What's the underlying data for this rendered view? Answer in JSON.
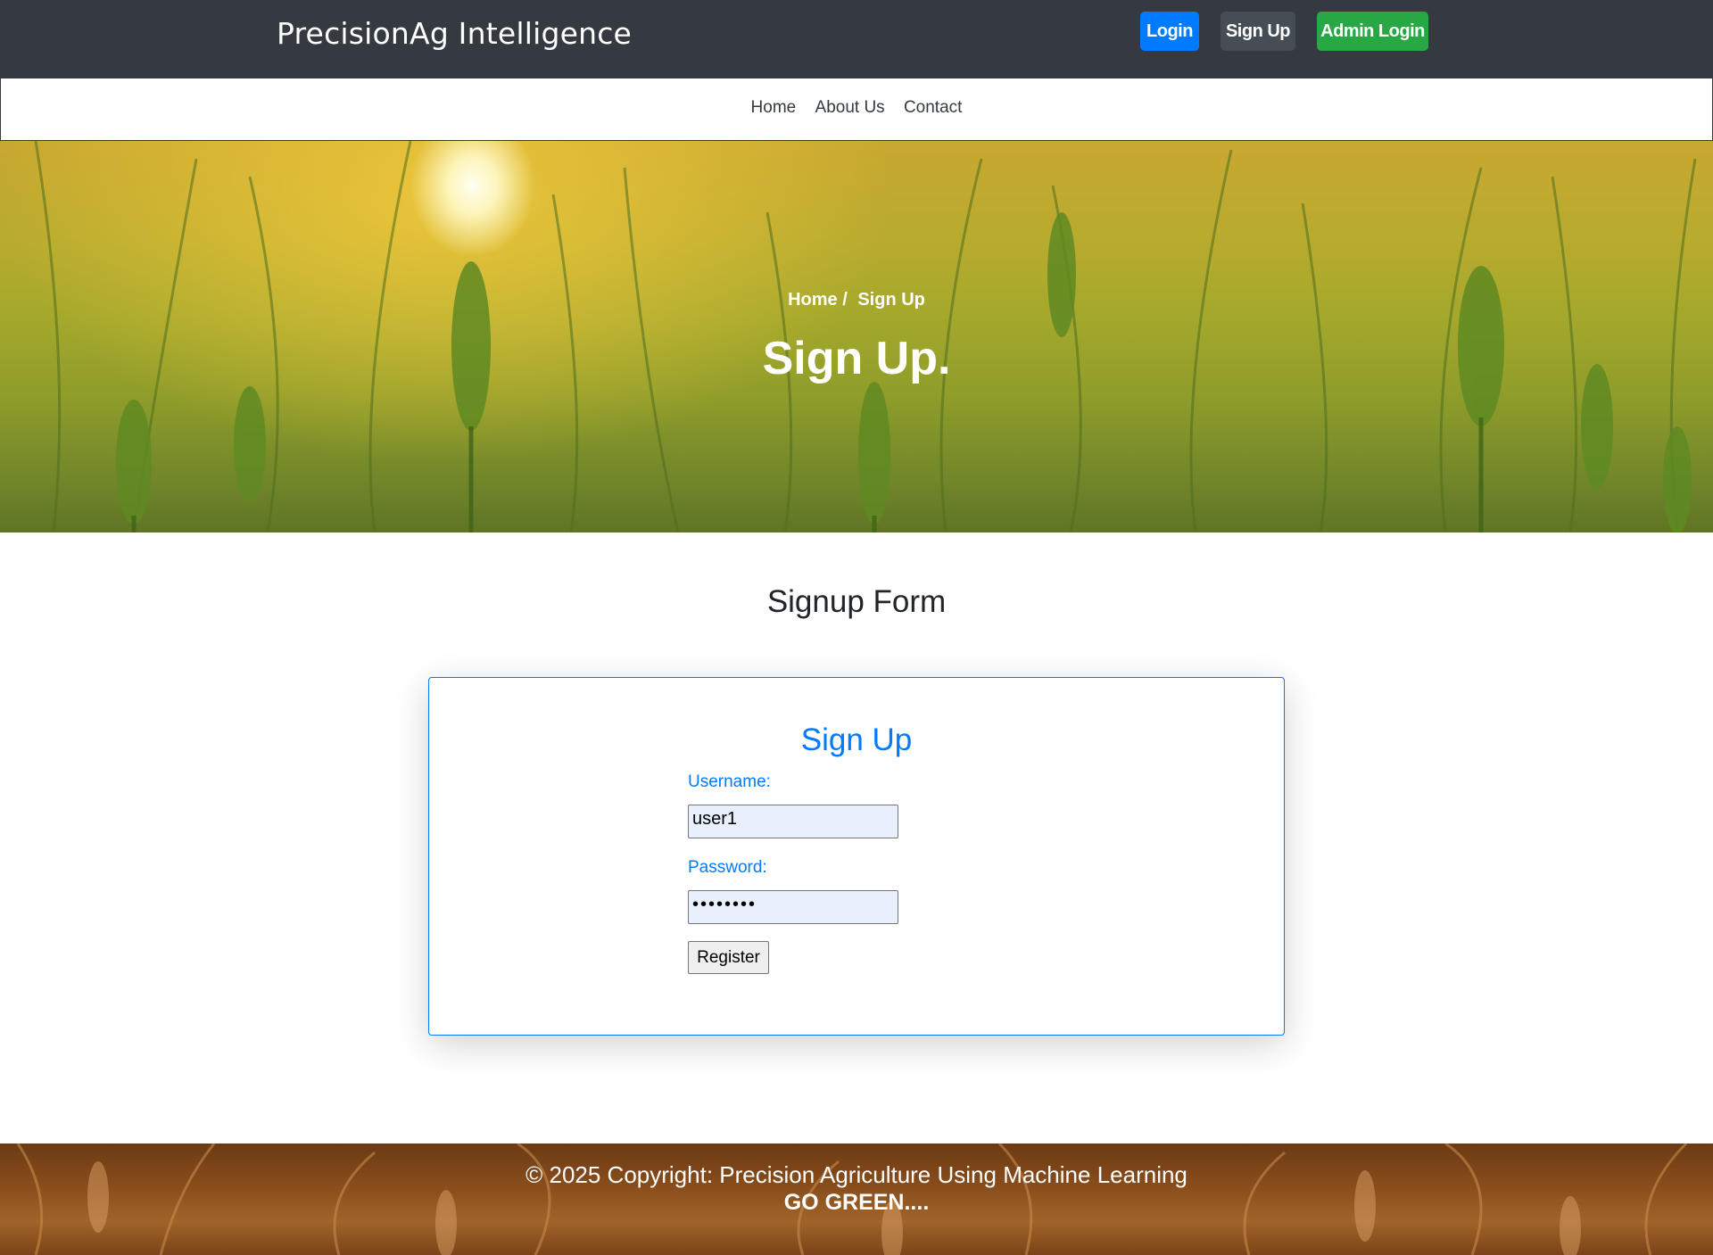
{
  "header": {
    "brand": "PrecisionAg Intelligence",
    "buttons": {
      "login": "Login",
      "signup": "Sign Up",
      "admin_login": "Admin Login"
    }
  },
  "nav": {
    "items": [
      "Home",
      "About Us",
      "Contact"
    ]
  },
  "hero": {
    "breadcrumb": {
      "home": "Home /",
      "current": "Sign Up"
    },
    "title": "Sign Up."
  },
  "main": {
    "section_title": "Signup Form",
    "form": {
      "title": "Sign Up",
      "username_label": "Username:",
      "username_value": "user1",
      "password_label": "Password:",
      "password_value": "••••••••",
      "submit_label": "Register"
    }
  },
  "footer": {
    "copyright": "© 2025 Copyright: Precision Agriculture Using Machine Learning",
    "tagline": "GO GREEN...."
  },
  "colors": {
    "topbar": "#343a40",
    "primary": "#007bff",
    "signup_button": "#454d55",
    "admin_button": "#28a745",
    "input_fill": "#e8f0fe"
  }
}
